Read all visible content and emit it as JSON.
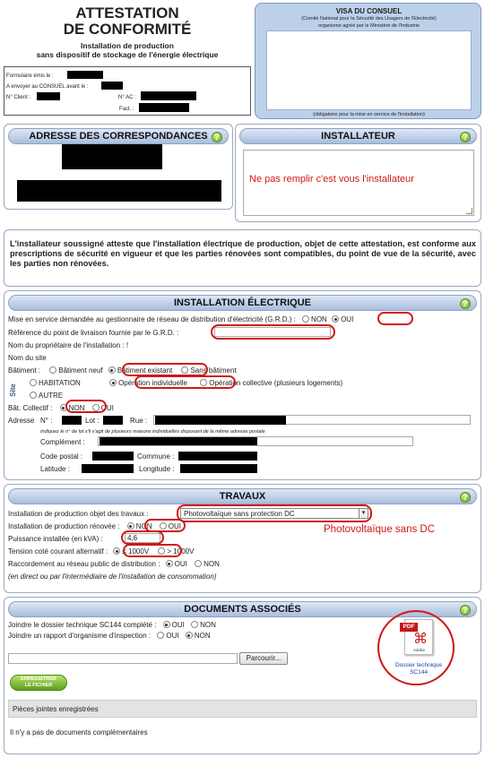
{
  "attestation": {
    "title_line1": "ATTESTATION",
    "title_line2": "DE CONFORMITÉ",
    "subtitle_line1": "Installation de production",
    "subtitle_line2": "sans dispositif de stockage de l'énergie électrique",
    "meta": {
      "formulaire_label": "Formulaire émis le :",
      "envoyer_label": "A envoyer au CONSUEL avant le :",
      "client_label": "N° Client :",
      "ac_label": "N° AC :",
      "fact_label": "Fact. :"
    }
  },
  "visa": {
    "title": "VISA DU CONSUEL",
    "line1": "(Comité National pour la Sécurité des Usagers de l'Electricité)",
    "line2": "organisme agréé par le Ministère de l'Industrie",
    "footer": "(obligatoire pour la mise en service de l'installation)"
  },
  "adresse": {
    "title": "ADRESSE DES CORRESPONDANCES"
  },
  "installateur": {
    "title": "INSTALLATEUR",
    "annotation": "Ne pas remplir c'est vous l'installateur"
  },
  "declaration": {
    "text": "L'installateur soussigné atteste que l'installation électrique de production, objet de cette attestation, est conforme aux prescriptions de sécurité en vigueur et que les parties rénovées sont compatibles, du point de vue de la sécurité, avec les parties non rénovées."
  },
  "installation": {
    "title": "INSTALLATION ÉLECTRIQUE",
    "mise_en_service": "Mise en service demandée au gestionnaire de réseau de distribution d'électricité (G.R.D.) :",
    "non": "NON",
    "oui": "OUI",
    "reference": "Référence du point de livraison fournie par le G.R.D. :",
    "proprietaire": "Nom du propriétaire de l'installation : !",
    "nom_site": "Nom du site",
    "batiment_label": "Bâtiment :",
    "batiment_options": [
      "Bâtiment neuf",
      "Bâtiment existant",
      "Sans bâtiment"
    ],
    "site_label": "Site",
    "type_options": [
      "HABITATION",
      "Opération individuelle",
      "Opération collective (plusieurs logements)"
    ],
    "autre": "AUTRE",
    "bat_collectif": "Bât. Collectif :",
    "adresse_label": "Adresse",
    "numero_label": "N° :",
    "lot_label": "Lot :",
    "rue_label": "Rue :",
    "indiquez": "Indiquez le n° de lot s'il s'agit de plusieurs maisons individuelles disposant de la même adresse postale",
    "complement": "Complément :",
    "code_postal": "Code postal :",
    "commune": "Commune :",
    "latitude": "Latitude :",
    "longitude": "Longitude :"
  },
  "travaux": {
    "title": "TRAVAUX",
    "objet_label": "Installation de production objet des travaux :",
    "objet_value": "Photovoltaïque sans protection DC",
    "annotation": "Photovoltaïque sans DC",
    "renovee_label": "Installation de production rénovée :",
    "puissance_label": "Puissance installée (en kVA) :",
    "puissance_value": "4,6",
    "tension_label": "Tension coté courant alternatif :",
    "tension_options": [
      "≤ 1000V",
      "> 1000V"
    ],
    "raccordement_label": "Raccordement au réseau public de distribution :",
    "note": "(en direct ou par l'intermédiaire de l'installation de consommation)"
  },
  "documents": {
    "title": "DOCUMENTS ASSOCIÉS",
    "joindre_sc144": "Joindre le dossier technique SC144 complété :",
    "joindre_rapport": "Joindre un rapport d'organisme d'inspection :",
    "parcourir": "Parcourir...",
    "enregistrer_line1": "ENREGISTRER",
    "enregistrer_line2": "LE FICHIER",
    "pieces": "Pièces jointes enregistrées",
    "empty": "Il n'y a pas de documents complémentaires",
    "pdf_badge": "PDF",
    "pdf_caption_line1": "Dossier technique",
    "pdf_caption_line2": "SC144",
    "adobe": "Adobe"
  },
  "colors": {
    "annotation_red": "#d01818",
    "header_blue": "#a9bddd",
    "panel_border": "#9aa8bf"
  }
}
